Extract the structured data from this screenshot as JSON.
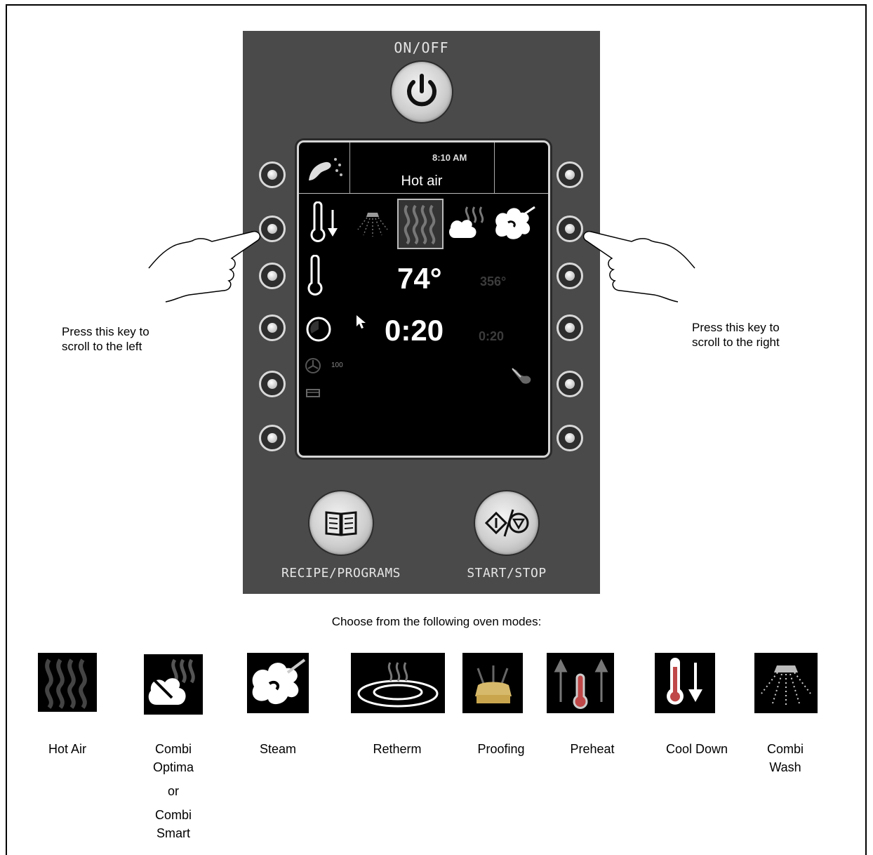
{
  "panel": {
    "onoff_label": "ON/OFF",
    "recipe_label": "RECIPE/PROGRAMS",
    "startstop_label": "START/STOP"
  },
  "screen": {
    "time": "8:10 AM",
    "mode_name": "Hot air",
    "temperature_set": "74°",
    "temperature_alt": "356°",
    "time_set": "0:20",
    "time_alt": "0:20",
    "fan_speed": "100"
  },
  "callouts": {
    "left": [
      "Press this key to",
      "scroll to the left"
    ],
    "right": [
      "Press this key to",
      "scroll to the right"
    ]
  },
  "choose_text": "Choose from the following oven modes:",
  "modes": [
    {
      "icon": "hot-air-icon",
      "label_lines": [
        "Hot Air"
      ]
    },
    {
      "icon": "combi-icon",
      "label_lines": [
        "Combi",
        "Optima",
        "or",
        "Combi",
        "Smart"
      ]
    },
    {
      "icon": "steam-icon",
      "label_lines": [
        "Steam"
      ]
    },
    {
      "icon": "retherm-icon",
      "label_lines": [
        "Retherm"
      ]
    },
    {
      "icon": "proofing-icon",
      "label_lines": [
        "Proofing"
      ]
    },
    {
      "icon": "preheat-icon",
      "label_lines": [
        "Preheat"
      ]
    },
    {
      "icon": "cool-down-icon",
      "label_lines": [
        "Cool Down"
      ]
    },
    {
      "icon": "combi-wash-icon",
      "label_lines": [
        "Combi",
        "Wash"
      ]
    }
  ]
}
